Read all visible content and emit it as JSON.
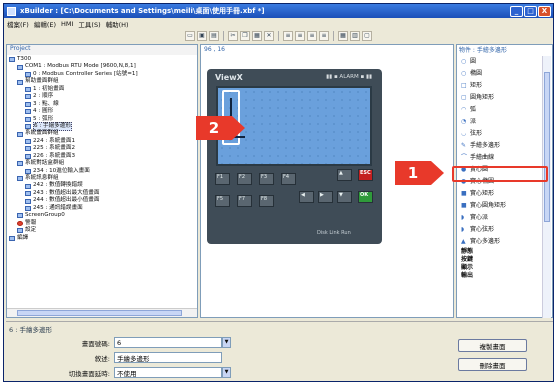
{
  "window": {
    "title": "xBuilder : [C:\\Documents and Settings\\meili\\桌面\\使用手冊.xbf *]",
    "minimize": "_",
    "maximize": "□",
    "close": "X"
  },
  "menu": [
    "檔案(F)",
    "編輯(E)",
    "HMI",
    "工具(S)",
    "輔助(H)"
  ],
  "toolbar_icons": [
    "new-icon",
    "open-icon",
    "save-icon",
    "cut-icon",
    "copy-icon",
    "paste-icon",
    "delete-icon",
    "align-icon",
    "align-icon",
    "align-icon",
    "align-icon",
    "grid-icon",
    "layout-icon",
    "panel-icon"
  ],
  "project": {
    "header": "Project",
    "items": [
      {
        "label": "T300",
        "indent": 0
      },
      {
        "label": "COM1 : Modbus RTU Mode [9600,N,8,1]",
        "indent": 1
      },
      {
        "label": "0 : Modbus Controller Series [站號=1]",
        "indent": 2
      },
      {
        "label": "幫助畫面群組",
        "indent": 1
      },
      {
        "label": "1 : 初始畫面",
        "indent": 2
      },
      {
        "label": "2 : 順序",
        "indent": 2
      },
      {
        "label": "3 : 點、線",
        "indent": 2
      },
      {
        "label": "4 : 圓形",
        "indent": 2
      },
      {
        "label": "5 : 弧形",
        "indent": 2
      },
      {
        "label": "6 : 手繪多邊形",
        "indent": 2,
        "selected": true
      },
      {
        "label": "系統畫面群組",
        "indent": 1
      },
      {
        "label": "224 : 系統畫面1",
        "indent": 2
      },
      {
        "label": "225 : 系統畫面2",
        "indent": 2
      },
      {
        "label": "226 : 系統畫面3",
        "indent": 2
      },
      {
        "label": "系統對話盒群組",
        "indent": 1
      },
      {
        "label": "234 : 10進位輸入畫面",
        "indent": 2
      },
      {
        "label": "系統訊息群組",
        "indent": 1
      },
      {
        "label": "242 : 數值轉換錯誤",
        "indent": 2
      },
      {
        "label": "243 : 數值超出最大值畫面",
        "indent": 2
      },
      {
        "label": "244 : 數值超出最小值畫面",
        "indent": 2
      },
      {
        "label": "245 : 通訊錯誤畫面",
        "indent": 2
      },
      {
        "label": "ScreenGroup0",
        "indent": 1
      },
      {
        "label": "警報",
        "indent": 1,
        "warn": true
      },
      {
        "label": "設定",
        "indent": 1
      },
      {
        "label": "編譯",
        "indent": 0
      }
    ]
  },
  "canvas": {
    "coords": "96 , 16",
    "brand": "ViewX",
    "alarm": "▮▮ ▪ ALARM ▪ ▮▮",
    "keys": [
      {
        "label": "F1"
      },
      {
        "label": "F2"
      },
      {
        "label": "F3"
      },
      {
        "label": "F4"
      },
      {
        "label": "▲"
      },
      {
        "label": "ESC"
      },
      {
        "label": "F5"
      },
      {
        "label": "F7"
      },
      {
        "label": "F8"
      },
      {
        "label": "◀"
      },
      {
        "label": "▶"
      },
      {
        "label": "▼"
      },
      {
        "label": "OK"
      }
    ],
    "footer": "Disk  Link  Run"
  },
  "objects": {
    "header": "物件 : 手繪多邊形",
    "items": [
      {
        "icon": "○",
        "label": "圓"
      },
      {
        "icon": "○",
        "label": "橢圓"
      },
      {
        "icon": "□",
        "label": "矩形"
      },
      {
        "icon": "▢",
        "label": "圓角矩形"
      },
      {
        "icon": "◠",
        "label": "弧"
      },
      {
        "icon": "◔",
        "label": "派"
      },
      {
        "icon": "◡",
        "label": "弦形"
      },
      {
        "icon": "✎",
        "label": "手繪多邊形",
        "selected": true
      },
      {
        "icon": "⌒",
        "label": "手繪曲線"
      },
      {
        "icon": "●",
        "label": "實心圓"
      },
      {
        "icon": "●",
        "label": "實心橢圓"
      },
      {
        "icon": "■",
        "label": "實心矩形"
      },
      {
        "icon": "■",
        "label": "實心圓角矩形"
      },
      {
        "icon": "◗",
        "label": "實心派"
      },
      {
        "icon": "◗",
        "label": "實心弦形"
      },
      {
        "icon": "▲",
        "label": "實心多邊形"
      }
    ],
    "groups": [
      "靜態",
      "按鍵",
      "顯示",
      "輸出"
    ]
  },
  "properties": {
    "title": "6 : 手繪多邊形",
    "screen_id_label": "畫面號碼:",
    "screen_id_value": "6",
    "description_label": "敘述:",
    "description_value": "手繪多邊形",
    "switch_label": "切換畫面延時:",
    "switch_value": "不使用",
    "copy_button": "複製畫面",
    "delete_button": "刪除畫面"
  },
  "callouts": {
    "one": "1",
    "two": "2"
  },
  "colors": {
    "callout": "#e8392a",
    "screen": "#6aa0dc",
    "device": "#3f4c57"
  }
}
